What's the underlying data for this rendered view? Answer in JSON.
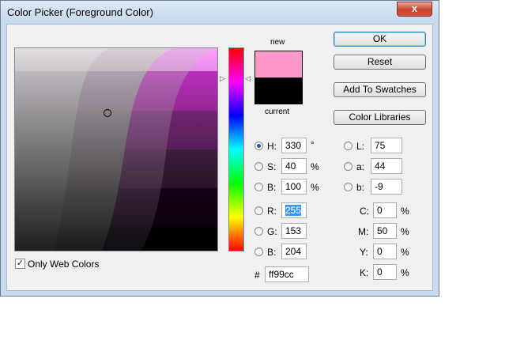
{
  "window": {
    "title": "Color Picker (Foreground Color)",
    "close_glyph": "x"
  },
  "preview": {
    "new_label": "new",
    "current_label": "current",
    "new_color": "#ff99cc",
    "current_color": "#000000"
  },
  "buttons": {
    "ok": "OK",
    "reset": "Reset",
    "add_to_swatches": "Add To Swatches",
    "color_libraries": "Color Libraries"
  },
  "fields": {
    "h": {
      "label": "H:",
      "value": "330",
      "unit": "°",
      "selected": true
    },
    "s": {
      "label": "S:",
      "value": "40",
      "unit": "%"
    },
    "b": {
      "label": "B:",
      "value": "100",
      "unit": "%"
    },
    "r": {
      "label": "R:",
      "value": "255"
    },
    "g": {
      "label": "G:",
      "value": "153"
    },
    "b2": {
      "label": "B:",
      "value": "204"
    },
    "l": {
      "label": "L:",
      "value": "75"
    },
    "a": {
      "label": "a:",
      "value": "44"
    },
    "lab_b": {
      "label": "b:",
      "value": "-9"
    },
    "c": {
      "label": "C:",
      "value": "0",
      "unit": "%"
    },
    "m": {
      "label": "M:",
      "value": "50",
      "unit": "%"
    },
    "y": {
      "label": "Y:",
      "value": "0",
      "unit": "%"
    },
    "k": {
      "label": "K:",
      "value": "0",
      "unit": "%"
    },
    "hex": {
      "label": "#",
      "value": "ff99cc"
    }
  },
  "only_web_colors": {
    "label": "Only Web Colors",
    "checked": true,
    "check_glyph": "✓"
  },
  "icons": {
    "hue_arrow_left": "▷",
    "hue_arrow_right": "◁"
  }
}
